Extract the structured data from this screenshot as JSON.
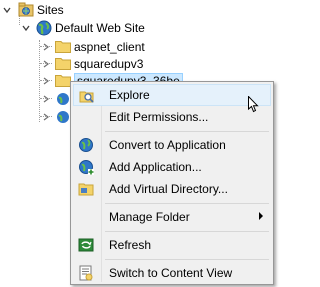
{
  "tree": {
    "sites_label": "Sites",
    "default_site_label": "Default Web Site",
    "folders": [
      "aspnet_client",
      "squaredupv3",
      "squaredupv3_36be"
    ]
  },
  "context_menu": {
    "items": [
      {
        "label": "Explore",
        "icon": "explore-icon"
      },
      {
        "label": "Edit Permissions...",
        "icon": ""
      },
      {
        "label": "Convert to Application",
        "icon": "convert-application-icon"
      },
      {
        "label": "Add Application...",
        "icon": "add-application-icon"
      },
      {
        "label": "Add Virtual Directory...",
        "icon": "add-virtual-directory-icon"
      },
      {
        "label": "Manage Folder",
        "icon": ""
      },
      {
        "label": "Refresh",
        "icon": "refresh-icon"
      },
      {
        "label": "Switch to Content View",
        "icon": "content-view-icon"
      }
    ]
  },
  "colors": {
    "selection": "#cce8ff",
    "menu_hover": "#e5f1fb",
    "folder": "#f4d36a"
  }
}
